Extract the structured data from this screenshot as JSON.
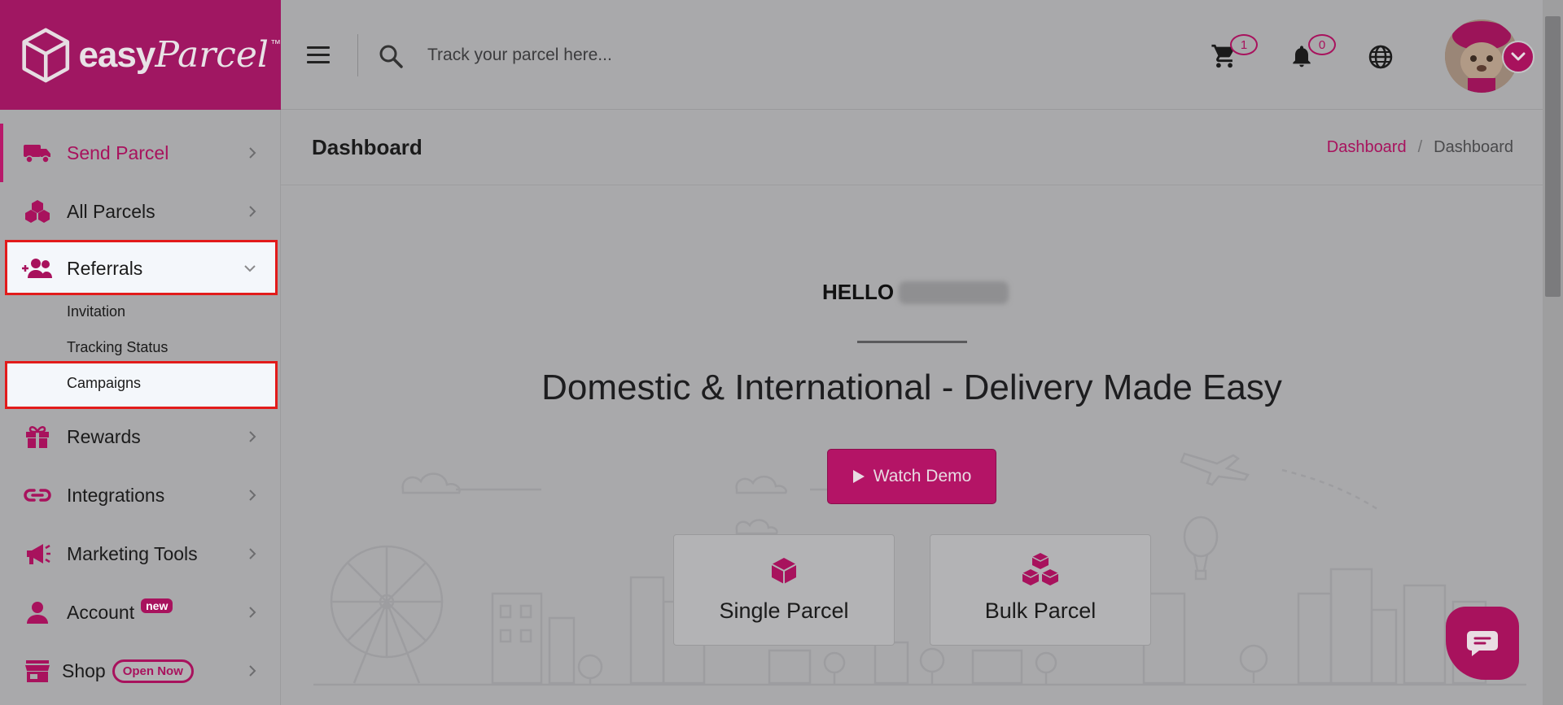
{
  "brand": {
    "name_easy": "easy",
    "name_parcel": "Parcel",
    "trademark": "™",
    "accent": "#a8125d"
  },
  "search": {
    "placeholder": "Track your parcel here..."
  },
  "header": {
    "cart_count": "1",
    "notification_count": "0"
  },
  "sidebar": {
    "items": [
      {
        "label": "Send Parcel"
      },
      {
        "label": "All Parcels"
      },
      {
        "label": "Referrals"
      },
      {
        "label": "Rewards"
      },
      {
        "label": "Integrations"
      },
      {
        "label": "Marketing Tools"
      },
      {
        "label": "Account",
        "badge": "new"
      },
      {
        "label": "Shop",
        "badge": "Open Now"
      }
    ],
    "referrals_sub": [
      "Invitation",
      "Tracking Status",
      "Campaigns"
    ]
  },
  "page": {
    "title": "Dashboard",
    "breadcrumb": {
      "link": "Dashboard",
      "separator": "/",
      "current": "Dashboard"
    }
  },
  "hero": {
    "greeting": "HELLO",
    "tagline": "Domestic & International - Delivery Made Easy",
    "demo_button": "Watch Demo",
    "cards": [
      {
        "label": "Single Parcel"
      },
      {
        "label": "Bulk Parcel"
      }
    ]
  }
}
